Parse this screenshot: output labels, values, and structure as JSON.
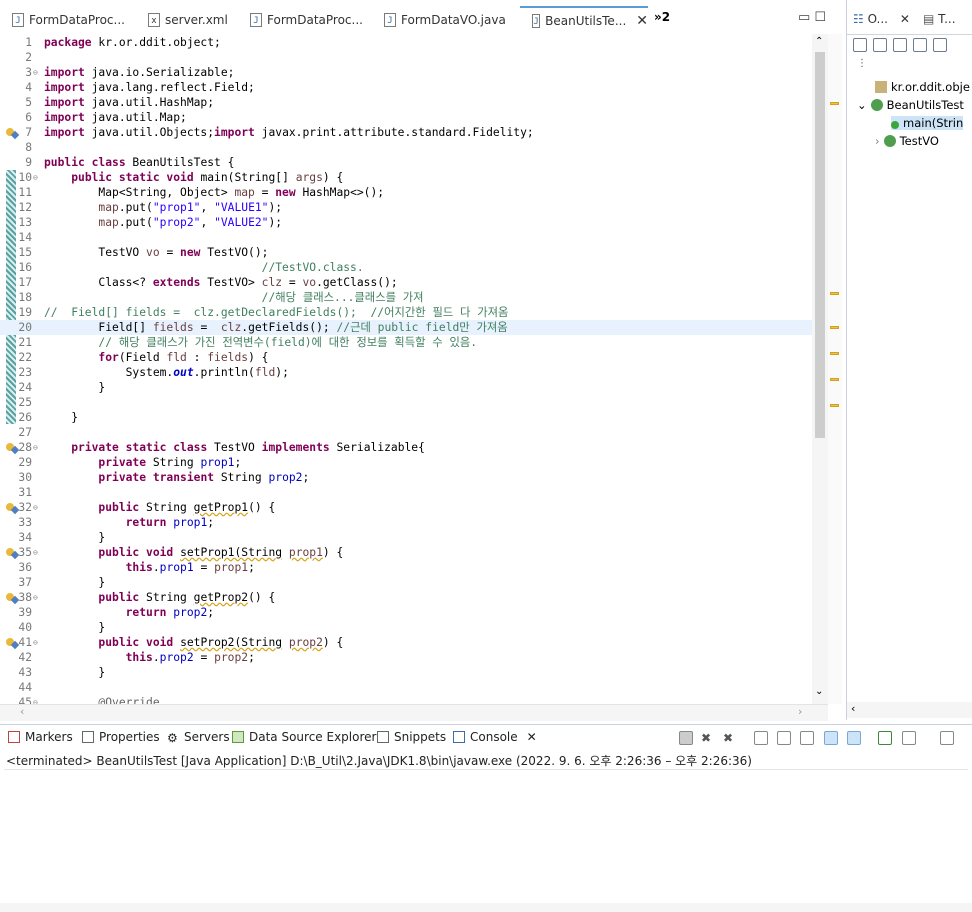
{
  "editor_tabs": [
    {
      "label": "FormDataProc...",
      "icon": "java-file-icon",
      "active": false
    },
    {
      "label": "server.xml",
      "icon": "xml-file-icon",
      "active": false
    },
    {
      "label": "FormDataProc...",
      "icon": "java-file-icon",
      "active": false
    },
    {
      "label": "FormDataVO.java",
      "icon": "java-file-icon",
      "active": false
    },
    {
      "label": "BeanUtilsTe...",
      "icon": "java-file-icon",
      "active": true
    }
  ],
  "editor_tabs_overflow": "»2",
  "outline": {
    "tabs": [
      {
        "label": "O..."
      },
      {
        "label": "T..."
      }
    ],
    "items": [
      {
        "label": "kr.or.ddit.obje",
        "icon": "package-icon"
      },
      {
        "label": "BeanUtilsTest",
        "icon": "class-icon"
      },
      {
        "label": "main(Strin",
        "icon": "method-icon"
      },
      {
        "label": "TestVO",
        "icon": "inner-class-icon"
      }
    ]
  },
  "console": {
    "tabs": [
      {
        "label": "Markers",
        "icon": "markers-icon"
      },
      {
        "label": "Properties",
        "icon": "properties-icon"
      },
      {
        "label": "Servers",
        "icon": "servers-icon"
      },
      {
        "label": "Data Source Explorer",
        "icon": "data-source-icon"
      },
      {
        "label": "Snippets",
        "icon": "snippets-icon"
      },
      {
        "label": "Console",
        "icon": "console-icon"
      }
    ],
    "status": "<terminated> BeanUtilsTest [Java Application] D:\\B_Util\\2.Java\\JDK1.8\\bin\\javaw.exe  (2022. 9. 6. 오후 2:26:36 – 오후 2:26:36)"
  },
  "code_lines": [
    {
      "n": "1",
      "t": "package kr.or.ddit.object;"
    },
    {
      "n": "2",
      "t": ""
    },
    {
      "n": "3",
      "t": "import java.io.Serializable;"
    },
    {
      "n": "4",
      "t": "import java.lang.reflect.Field;"
    },
    {
      "n": "5",
      "t": "import java.util.HashMap;"
    },
    {
      "n": "6",
      "t": "import java.util.Map;"
    },
    {
      "n": "7",
      "t": "import java.util.Objects;import javax.print.attribute.standard.Fidelity;"
    },
    {
      "n": "8",
      "t": ""
    },
    {
      "n": "9",
      "t": "public class BeanUtilsTest {"
    },
    {
      "n": "10",
      "t": "    public static void main(String[] args) {"
    },
    {
      "n": "11",
      "t": "        Map<String, Object> map = new HashMap<>();"
    },
    {
      "n": "12",
      "t": "        map.put(\"prop1\", \"VALUE1\");"
    },
    {
      "n": "13",
      "t": "        map.put(\"prop2\", \"VALUE2\");"
    },
    {
      "n": "14",
      "t": ""
    },
    {
      "n": "15",
      "t": "        TestVO vo = new TestVO();"
    },
    {
      "n": "16",
      "t": "                                //TestVO.class."
    },
    {
      "n": "17",
      "t": "        Class<? extends TestVO> clz = vo.getClass();"
    },
    {
      "n": "18",
      "t": "                                //해당 클래스...클래스를 가져"
    },
    {
      "n": "19",
      "t": "//  Field[] fields =  clz.getDeclaredFields();  //어지간한 필드 다 가져옴"
    },
    {
      "n": "20",
      "t": "        Field[] fields =  clz.getFields(); //근데 public field만 가져옴"
    },
    {
      "n": "21",
      "t": "        // 해당 클래스가 가진 전역변수(field)에 대한 정보를 획득할 수 있음."
    },
    {
      "n": "22",
      "t": "        for(Field fld : fields) {"
    },
    {
      "n": "23",
      "t": "            System.out.println(fld);"
    },
    {
      "n": "24",
      "t": "        }"
    },
    {
      "n": "25",
      "t": ""
    },
    {
      "n": "26",
      "t": "    }"
    },
    {
      "n": "27",
      "t": ""
    },
    {
      "n": "28",
      "t": "    private static class TestVO implements Serializable{"
    },
    {
      "n": "29",
      "t": "        private String prop1;"
    },
    {
      "n": "30",
      "t": "        private transient String prop2;"
    },
    {
      "n": "31",
      "t": ""
    },
    {
      "n": "32",
      "t": "        public String getProp1() {"
    },
    {
      "n": "33",
      "t": "            return prop1;"
    },
    {
      "n": "34",
      "t": "        }"
    },
    {
      "n": "35",
      "t": "        public void setProp1(String prop1) {"
    },
    {
      "n": "36",
      "t": "            this.prop1 = prop1;"
    },
    {
      "n": "37",
      "t": "        }"
    },
    {
      "n": "38",
      "t": "        public String getProp2() {"
    },
    {
      "n": "39",
      "t": "            return prop2;"
    },
    {
      "n": "40",
      "t": "        }"
    },
    {
      "n": "41",
      "t": "        public void setProp2(String prop2) {"
    },
    {
      "n": "42",
      "t": "            this.prop2 = prop2;"
    },
    {
      "n": "43",
      "t": "        }"
    },
    {
      "n": "44",
      "t": ""
    },
    {
      "n": "45",
      "t": "        @Override"
    }
  ],
  "colors": {
    "keyword": "#7f0055",
    "string": "#2a00ff",
    "comment": "#3f7f5f",
    "field": "#0000c0",
    "current_line": "#e8f2fe"
  }
}
